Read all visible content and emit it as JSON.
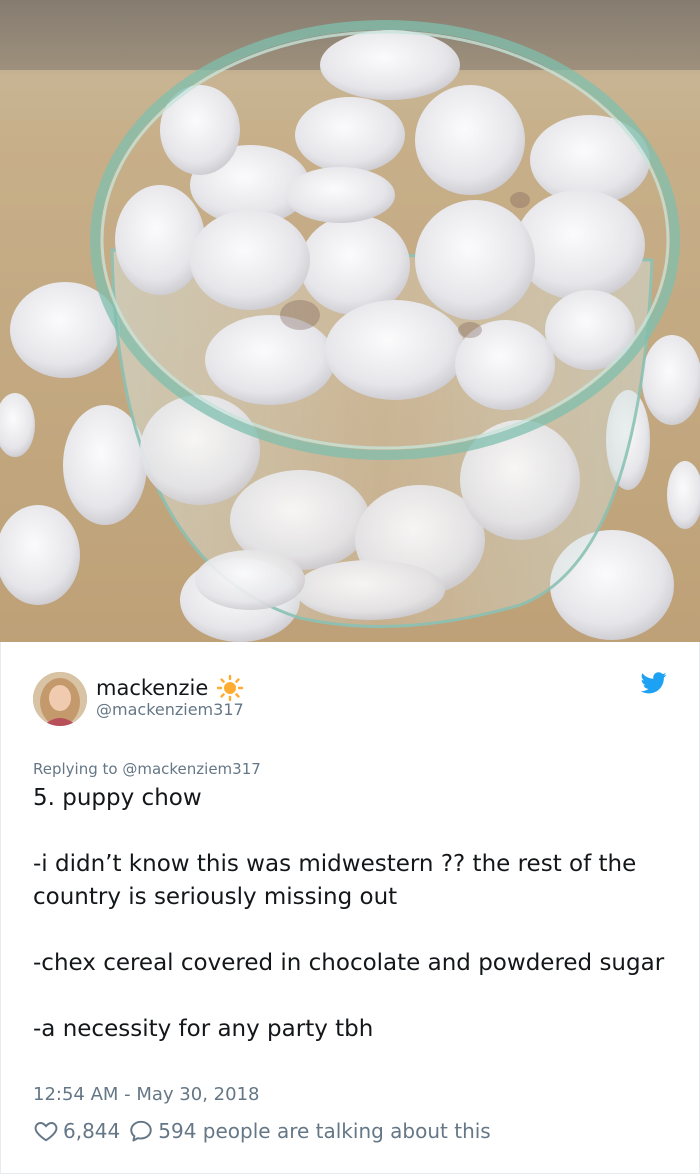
{
  "photo": {
    "subject": "bowl of puppy chow"
  },
  "tweet": {
    "display_name": "mackenzie",
    "name_emoji": "sun-icon",
    "handle": "@mackenziem317",
    "replying_to": "Replying to @mackenziem317",
    "body": "5. puppy chow\n\n-i didn’t know this was midwestern ?? the rest of the country is seriously missing out\n\n-chex cereal covered in chocolate and powdered sugar\n\n-a necessity for any party tbh",
    "timestamp": "12:54 AM - May 30, 2018",
    "likes": "6,844",
    "talking": "594 people are talking about this"
  },
  "colors": {
    "twitter_blue": "#1da1f2",
    "muted": "#657786",
    "text": "#14171a",
    "sun": "#ffac33"
  }
}
